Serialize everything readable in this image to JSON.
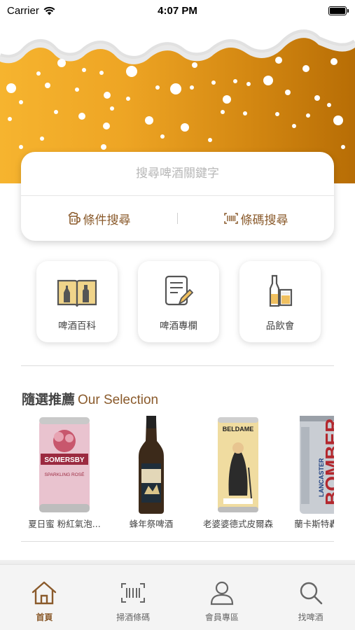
{
  "status_bar": {
    "carrier": "Carrier",
    "time": "4:07 PM"
  },
  "search": {
    "placeholder": "搜尋啤酒關鍵字",
    "condition_label": "條件搜尋",
    "barcode_label": "條碼搜尋"
  },
  "features": [
    {
      "label": "啤酒百科",
      "icon": "book-icon"
    },
    {
      "label": "啤酒專欄",
      "icon": "article-icon"
    },
    {
      "label": "品飲會",
      "icon": "tasting-icon"
    }
  ],
  "section": {
    "title_zh": "隨選推薦",
    "title_en": "Our Selection"
  },
  "products": [
    {
      "name": "夏日蜜 粉紅氣泡...",
      "can_text": "SOMERSBY",
      "sub_text": "SPARKLING ROSÉ"
    },
    {
      "name": "蜂年祭啤酒"
    },
    {
      "name": "老婆婆德式皮爾森",
      "can_text": "BELDAME"
    },
    {
      "name": "蘭卡斯特轟炸機",
      "can_text": "BOMBER",
      "sub_text": "LANCASTER"
    }
  ],
  "tabs": [
    {
      "label": "首頁",
      "icon": "home-icon",
      "active": true
    },
    {
      "label": "掃酒條碼",
      "icon": "barcode-icon",
      "active": false
    },
    {
      "label": "會員專區",
      "icon": "user-icon",
      "active": false
    },
    {
      "label": "找啤酒",
      "icon": "search-icon",
      "active": false
    }
  ],
  "colors": {
    "accent": "#8a5a2b",
    "beer_light": "#f6b42f",
    "beer_dark": "#b76d05"
  }
}
